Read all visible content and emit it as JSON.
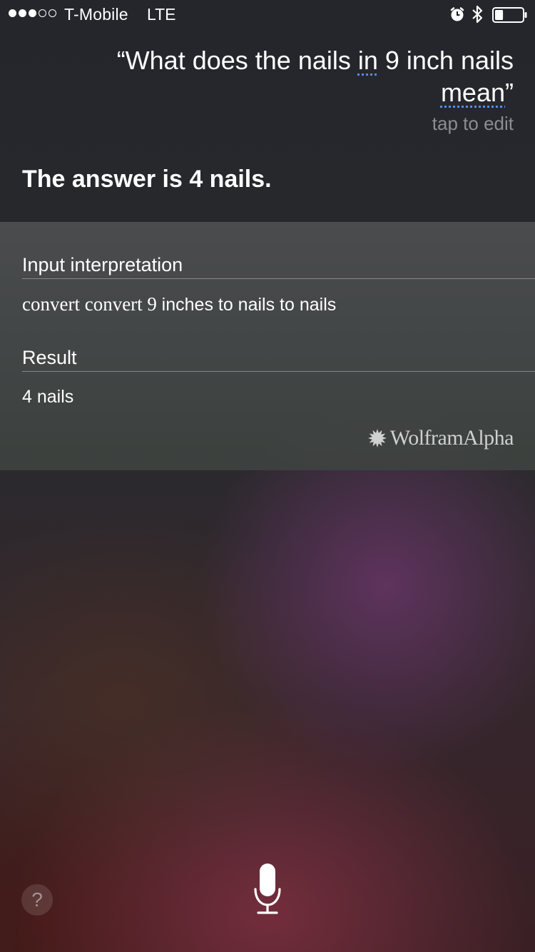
{
  "status_bar": {
    "signal": {
      "filled": 3,
      "total": 5
    },
    "carrier": "T-Mobile",
    "network": "LTE",
    "icons": [
      "alarm-icon",
      "bluetooth-icon",
      "battery-icon"
    ],
    "battery_level": 0.3
  },
  "siri": {
    "query_open": "“What does the nails ",
    "query_w1": "in",
    "query_mid": " 9 inch nails ",
    "query_w2": "mean",
    "query_close": "”",
    "tap_to_edit": "tap to edit",
    "answer": "The answer is 4 nails."
  },
  "card": {
    "input_title": "Input interpretation",
    "input_serif": "convert convert 9 ",
    "input_sans": "inches to nails to nails",
    "result_title": "Result",
    "result_value": "4 nails",
    "brand": "WolframAlpha"
  },
  "controls": {
    "help": "?",
    "mic_icon": "microphone-icon"
  },
  "colors": {
    "underline": "#4f8ef7",
    "muted_text": "#8a8d93"
  }
}
